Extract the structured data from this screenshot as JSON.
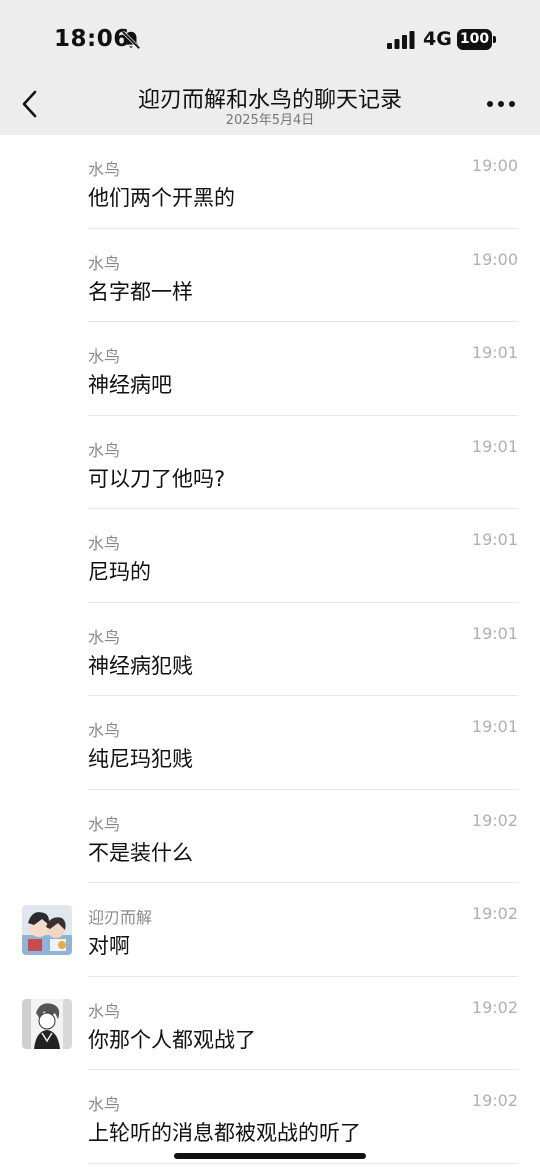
{
  "status": {
    "time": "18:06",
    "network": "4G",
    "battery": "100"
  },
  "header": {
    "title": "迎刃而解和水鸟的聊天记录",
    "date": "2025年5月4日"
  },
  "messages": [
    {
      "sender": "水鸟",
      "time": "19:00",
      "text": "他们两个开黑的",
      "avatar": "none"
    },
    {
      "sender": "水鸟",
      "time": "19:00",
      "text": "名字都一样",
      "avatar": "none"
    },
    {
      "sender": "水鸟",
      "time": "19:01",
      "text": "神经病吧",
      "avatar": "none"
    },
    {
      "sender": "水鸟",
      "time": "19:01",
      "text": "可以刀了他吗?",
      "avatar": "none"
    },
    {
      "sender": "水鸟",
      "time": "19:01",
      "text": "尼玛的",
      "avatar": "none"
    },
    {
      "sender": "水鸟",
      "time": "19:01",
      "text": "神经病犯贱",
      "avatar": "none"
    },
    {
      "sender": "水鸟",
      "time": "19:01",
      "text": "纯尼玛犯贱",
      "avatar": "none"
    },
    {
      "sender": "水鸟",
      "time": "19:02",
      "text": "不是装什么",
      "avatar": "none"
    },
    {
      "sender": "迎刃而解",
      "time": "19:02",
      "text": "对啊",
      "avatar": "color-anime-avatar"
    },
    {
      "sender": "水鸟",
      "time": "19:02",
      "text": "你那个人都观战了",
      "avatar": "sketch-anime-avatar"
    },
    {
      "sender": "水鸟",
      "time": "19:02",
      "text": "上轮听的消息都被观战的听了",
      "avatar": "none"
    }
  ],
  "icons": {
    "back": "chevron-left-icon",
    "more": "more-dots-icon",
    "mute": "bell-slash-icon",
    "signal": "signal-bars-icon"
  },
  "colors": {
    "header_bg": "#ededed",
    "text": "#111111",
    "sender": "#8a8a8a",
    "time": "#b0b0b0",
    "divider": "#e6e6e6"
  }
}
